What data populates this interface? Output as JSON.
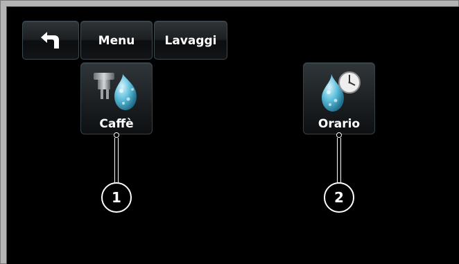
{
  "toolbar": {
    "back": {
      "icon": "back-arrow-icon"
    },
    "menu_label": "Menu",
    "lavaggi_label": "Lavaggi"
  },
  "tiles": [
    {
      "label": "Caffè",
      "icon": "coffee-group-wash-icon"
    },
    {
      "label": "Orario",
      "icon": "timed-wash-clock-icon"
    }
  ],
  "callouts": [
    "1",
    "2"
  ],
  "colors": {
    "screen_background": "#000000",
    "frame": "#b4b4b4",
    "button_border": "#3c4a52",
    "text": "#ffffff",
    "drop_blue": "#57b9d6"
  }
}
